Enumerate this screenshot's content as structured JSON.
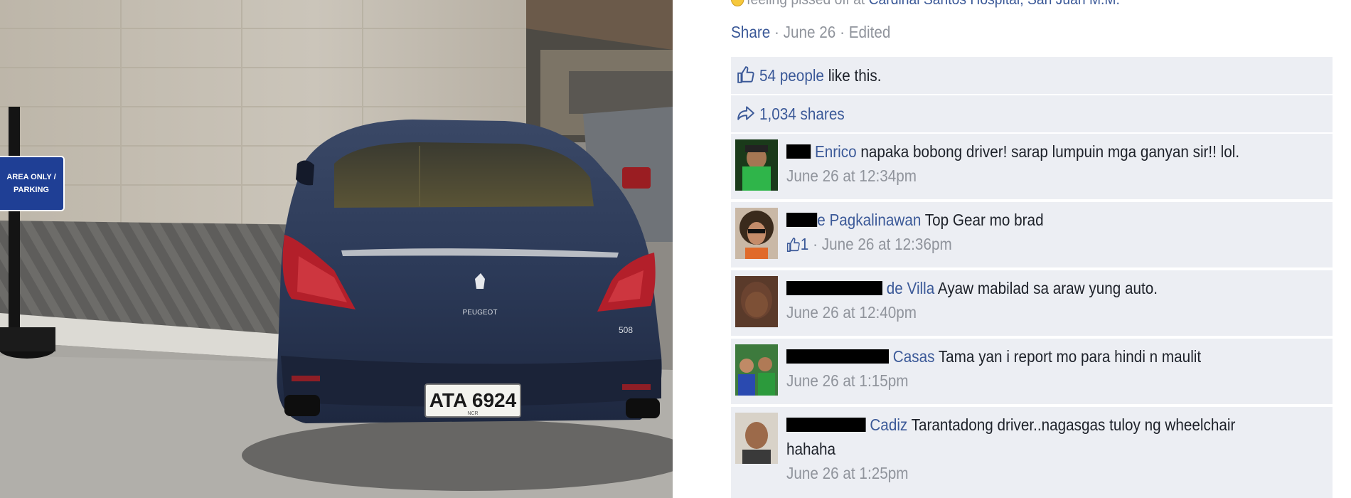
{
  "post": {
    "feeling_text": "feeling pissed off at",
    "place": "Cardinal Santos Hospital, San Juan M.M.",
    "share_label": "Share",
    "date": "June 26",
    "edited_label": "Edited",
    "likes_text": "54 people",
    "likes_suffix": "like this.",
    "shares_text": "1,034 shares"
  },
  "photo": {
    "sign_text_line1": "AREA ONLY /",
    "sign_text_line2": "PARKING",
    "plate": "ATA 6924",
    "plate_sub": "NCR",
    "badge": "PEUGEOT",
    "model": "508"
  },
  "comments": [
    {
      "author": "Enrico",
      "text": "napaka bobong driver! sarap lumpuin mga ganyan sir!! lol.",
      "time": "June 26 at 12:34pm"
    },
    {
      "author": "e Pagkalinawan",
      "text": "Top Gear mo brad",
      "likes": "1",
      "time": "June 26 at 12:36pm"
    },
    {
      "author": "de Villa",
      "text": "Ayaw mabilad sa araw yung auto.",
      "time": "June 26 at 12:40pm"
    },
    {
      "author": "Casas",
      "text": "Tama yan i report mo para hindi n maulit",
      "time": "June 26 at 1:15pm"
    },
    {
      "author": "Cadiz",
      "text": "Tarantadong driver..nagasgas tuloy ng wheelchair",
      "text2": "hahaha",
      "time": "June 26 at 1:25pm"
    }
  ]
}
